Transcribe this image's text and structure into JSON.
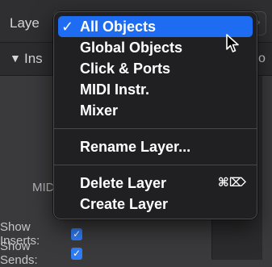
{
  "inspector": {
    "layer_label": "Laye",
    "popup_arrows": "◇",
    "inspector_label": "Ins",
    "right_fragment": "o",
    "fragment_a": "A",
    "fragment_mid": "MID",
    "show_inserts_label": "Show Inserts:",
    "show_sends_label": "Show Sends:",
    "show_inserts_checked": true,
    "show_sends_checked": true
  },
  "menu": {
    "check": "✓",
    "items": [
      {
        "label": "All Objects",
        "selected": true
      },
      {
        "label": "Global Objects"
      },
      {
        "label": "Click & Ports"
      },
      {
        "label": "MIDI Instr."
      },
      {
        "label": "Mixer"
      }
    ],
    "rename_label": "Rename Layer...",
    "delete_label": "Delete Layer",
    "delete_shortcut": "⌘⌦",
    "create_label": "Create Layer"
  },
  "colors": {
    "selection": "#1d6cf2",
    "checkbox": "#2f7cf6"
  }
}
